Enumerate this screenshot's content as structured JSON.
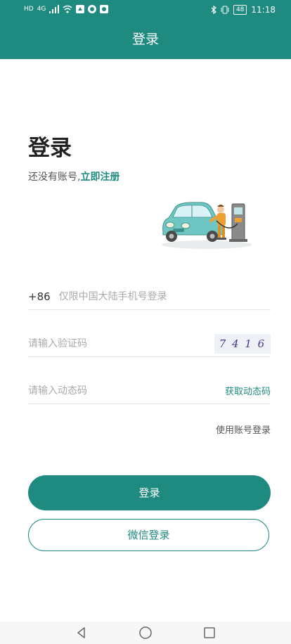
{
  "status_bar": {
    "network_labels": [
      "HD",
      "4G"
    ],
    "battery": "48",
    "time": "11:18"
  },
  "header": {
    "title": "登录"
  },
  "main": {
    "title": "登录",
    "register_prompt": "还没有账号,",
    "register_link": "立即注册",
    "phone": {
      "prefix": "+86",
      "placeholder": "仅限中国大陆手机号登录"
    },
    "captcha": {
      "placeholder": "请输入验证码",
      "digits": "7 4 1 6"
    },
    "dynamic_code": {
      "placeholder": "请输入动态码",
      "get_code_label": "获取动态码"
    },
    "account_login_label": "使用账号登录",
    "login_button": "登录",
    "wechat_login_button": "微信登录"
  },
  "colors": {
    "brand": "#1e8a80",
    "background": "#ffffff"
  },
  "icons": [
    "signal-icon",
    "wifi-icon",
    "bluetooth-icon",
    "vibrate-icon",
    "back-icon",
    "home-icon",
    "recents-icon"
  ]
}
